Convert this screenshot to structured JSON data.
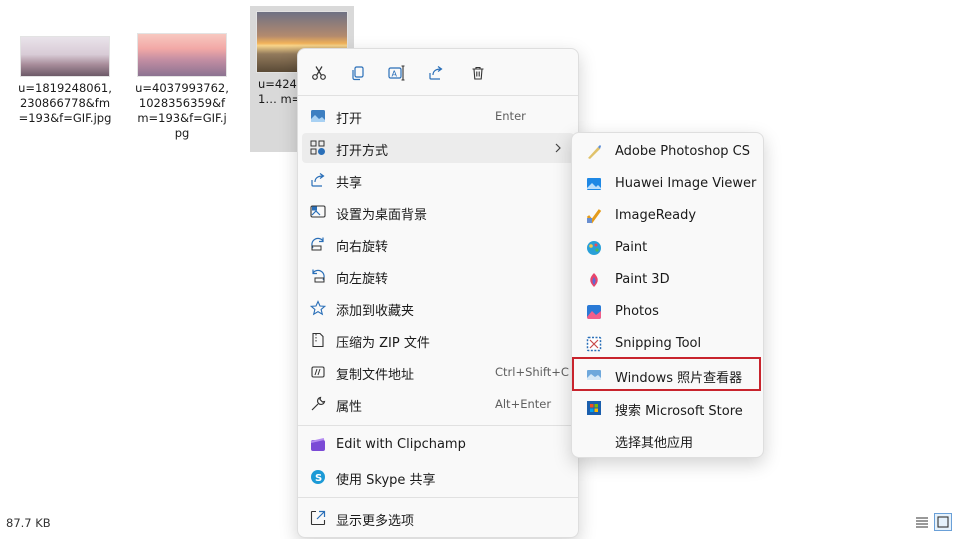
{
  "files": [
    {
      "name": "u=1819248061,230866778&fm=193&f=GIF.jpg"
    },
    {
      "name": "u=4037993762,1028356359&fm=193&f=GIF.jpg"
    },
    {
      "name": "u=424… 32351… m=19…"
    }
  ],
  "context_menu": {
    "toolbar": [
      "cut-icon",
      "copy-icon",
      "rename-icon",
      "share-icon",
      "delete-icon"
    ],
    "items": [
      {
        "label": "打开",
        "shortcut": "Enter",
        "icon": "image-icon"
      },
      {
        "label": "打开方式",
        "icon": "open-with-icon",
        "has_submenu": true
      },
      {
        "label": "共享",
        "icon": "share-icon"
      },
      {
        "label": "设置为桌面背景",
        "icon": "desktop-background-icon"
      },
      {
        "label": "向右旋转",
        "icon": "rotate-right-icon"
      },
      {
        "label": "向左旋转",
        "icon": "rotate-left-icon"
      },
      {
        "label": "添加到收藏夹",
        "icon": "star-icon"
      },
      {
        "label": "压缩为 ZIP 文件",
        "icon": "zip-icon"
      },
      {
        "label": "复制文件地址",
        "shortcut": "Ctrl+Shift+C",
        "icon": "copy-path-icon"
      },
      {
        "label": "属性",
        "shortcut": "Alt+Enter",
        "icon": "wrench-icon"
      }
    ],
    "extra_items": [
      {
        "label": "Edit with Clipchamp",
        "icon": "clipchamp-icon"
      },
      {
        "label": "使用 Skype 共享",
        "icon": "skype-icon"
      }
    ],
    "more_options": {
      "label": "显示更多选项",
      "icon": "more-options-icon"
    }
  },
  "submenu": {
    "items": [
      {
        "label": "Adobe Photoshop CS",
        "icon": "photoshop-icon"
      },
      {
        "label": "Huawei Image Viewer",
        "icon": "huawei-image-viewer-icon"
      },
      {
        "label": "ImageReady",
        "icon": "imageready-icon"
      },
      {
        "label": "Paint",
        "icon": "paint-icon"
      },
      {
        "label": "Paint 3D",
        "icon": "paint3d-icon"
      },
      {
        "label": "Photos",
        "icon": "photos-icon"
      },
      {
        "label": "Snipping Tool",
        "icon": "snipping-tool-icon"
      },
      {
        "label": "Windows 照片查看器",
        "icon": "windows-photo-viewer-icon",
        "highlighted": true
      },
      {
        "label": "搜索 Microsoft Store",
        "icon": "microsoft-store-icon"
      },
      {
        "label": "选择其他应用",
        "icon": ""
      }
    ]
  },
  "status": {
    "size": "87.7 KB"
  },
  "colors": {
    "highlight_box": "#c8242d",
    "menu_bg": "#f9f9f9",
    "accent": "#0067c0"
  }
}
